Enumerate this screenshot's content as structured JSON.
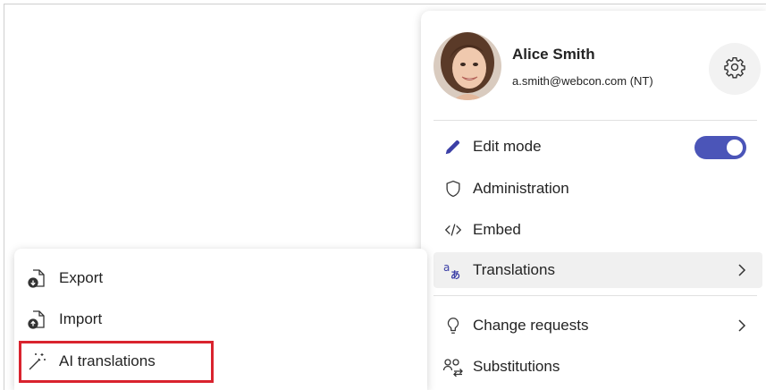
{
  "user": {
    "name": "Alice Smith",
    "email": "a.smith@webcon.com  (NT)"
  },
  "menu": {
    "items": [
      {
        "label": "Edit mode",
        "icon": "pencil-icon",
        "toggle_on": true
      },
      {
        "label": "Administration",
        "icon": "shield-icon"
      },
      {
        "label": "Embed",
        "icon": "code-icon"
      },
      {
        "label": "Translations",
        "icon": "translate-icon",
        "active": true
      },
      {
        "label": "Change requests",
        "icon": "lightbulb-icon"
      },
      {
        "label": "Substitutions",
        "icon": "people-swap-icon"
      }
    ]
  },
  "submenu": {
    "items": [
      {
        "label": "Export",
        "icon": "document-export-icon"
      },
      {
        "label": "Import",
        "icon": "document-import-icon"
      },
      {
        "label": "AI translations",
        "icon": "magic-wand-icon",
        "highlighted": true
      }
    ]
  },
  "colors": {
    "accent": "#4b55b8",
    "highlight": "#d9232e",
    "active_bg": "#f0f0f0"
  }
}
